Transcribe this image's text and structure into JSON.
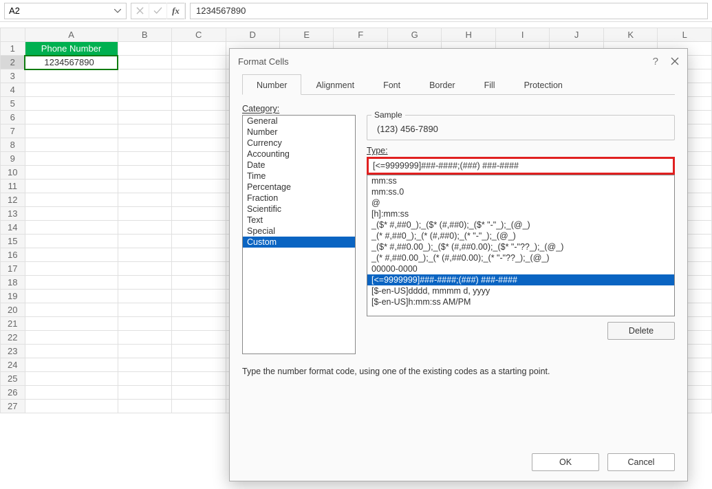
{
  "nameBox": "A2",
  "formulaValue": "1234567890",
  "columns": [
    "A",
    "B",
    "C",
    "D",
    "E",
    "F",
    "G",
    "H",
    "I",
    "J",
    "K",
    "L"
  ],
  "rowCount": 27,
  "cells": {
    "A1": "Phone Number",
    "A2": "1234567890"
  },
  "dialog": {
    "title": "Format Cells",
    "help": "?",
    "tabs": [
      "Number",
      "Alignment",
      "Font",
      "Border",
      "Fill",
      "Protection"
    ],
    "activeTab": "Number",
    "categoryLabel": "Category:",
    "categories": [
      "General",
      "Number",
      "Currency",
      "Accounting",
      "Date",
      "Time",
      "Percentage",
      "Fraction",
      "Scientific",
      "Text",
      "Special",
      "Custom"
    ],
    "selectedCategory": "Custom",
    "sampleLabel": "Sample",
    "sampleValue": "(123) 456-7890",
    "typeLabel": "Type:",
    "typeValue": "[<=9999999]###-####;(###) ###-####",
    "formats": [
      "mm:ss",
      "mm:ss.0",
      "@",
      "[h]:mm:ss",
      "_($* #,##0_);_($* (#,##0);_($* \"-\"_);_(@_)",
      "_(* #,##0_);_(* (#,##0);_(* \"-\"_);_(@_)",
      "_($* #,##0.00_);_($* (#,##0.00);_($* \"-\"??_);_(@_)",
      "_(* #,##0.00_);_(* (#,##0.00);_(* \"-\"??_);_(@_)",
      "00000-0000",
      "[<=9999999]###-####;(###) ###-####",
      "[$-en-US]dddd, mmmm d, yyyy",
      "[$-en-US]h:mm:ss AM/PM"
    ],
    "selectedFormatIndex": 9,
    "deleteBtn": "Delete",
    "hint": "Type the number format code, using one of the existing codes as a starting point.",
    "ok": "OK",
    "cancel": "Cancel"
  }
}
